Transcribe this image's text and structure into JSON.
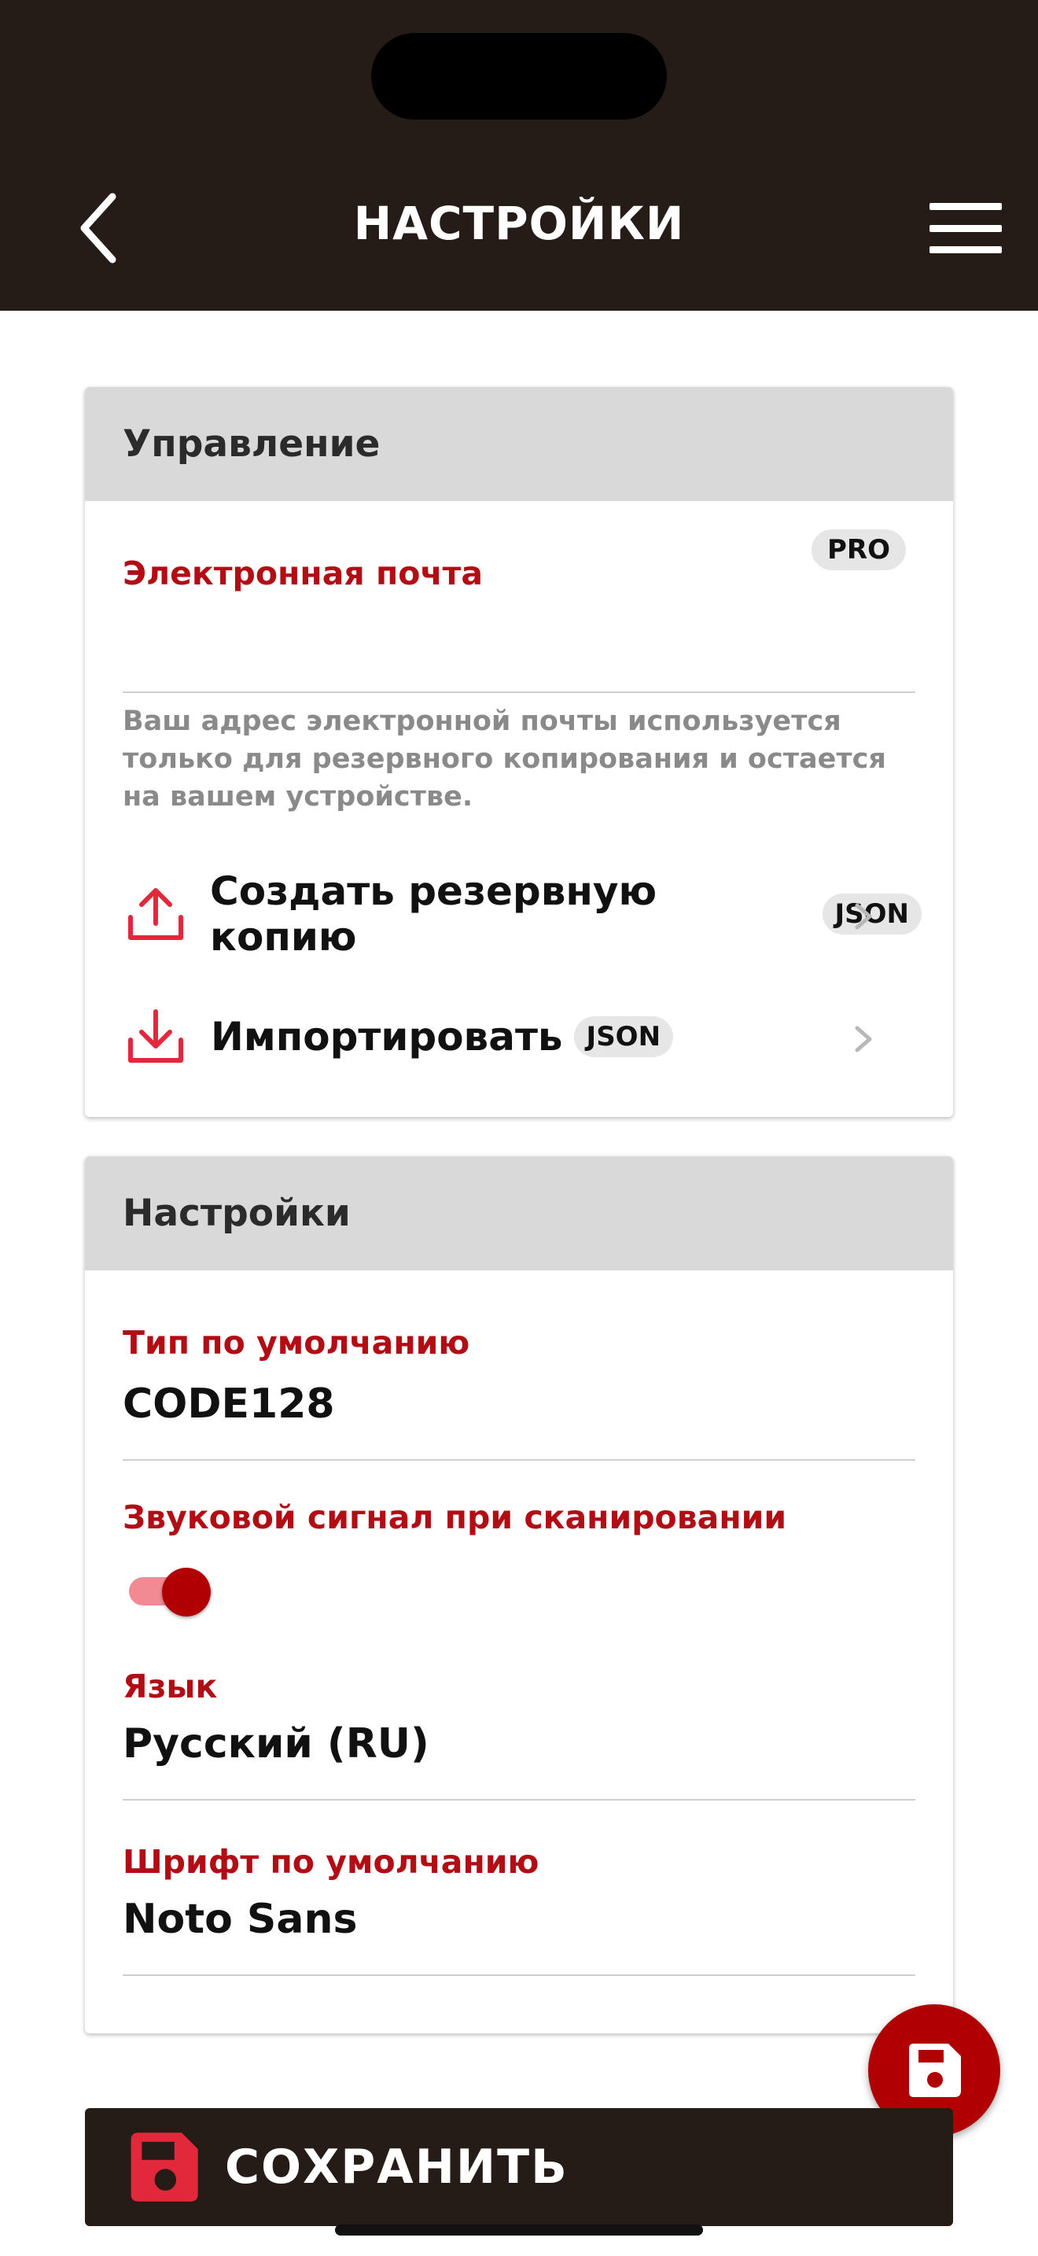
{
  "header": {
    "title": "НАСТРОЙКИ",
    "back_icon": "chevron-left-icon",
    "menu_icon": "hamburger-menu-icon"
  },
  "management": {
    "heading": "Управление",
    "email_label": "Электронная почта",
    "email_value": "",
    "pro_badge": "PRO",
    "email_hint": "Ваш адрес электронной почты используется только для резервного копирования и остается на вашем устройстве.",
    "backup_label": "Создать резервную копию",
    "backup_badge": "JSON",
    "import_label": "Импортировать",
    "import_badge": "JSON"
  },
  "settings": {
    "heading": "Настройки",
    "type_label": "Тип по умолчанию",
    "type_value": "CODE128",
    "beep_label": "Звуковой сигнал при сканировании",
    "beep_enabled": true,
    "language_label": "Язык",
    "language_value": "Русский (RU)",
    "font_label": "Шрифт по умолчанию",
    "font_value": "Noto Sans"
  },
  "save_button": {
    "label": "СОХРАНИТЬ",
    "icon": "floppy-disk-icon"
  },
  "colors": {
    "header_bg": "#251c17",
    "accent_red": "#b10004",
    "label_red": "#b20d14"
  }
}
